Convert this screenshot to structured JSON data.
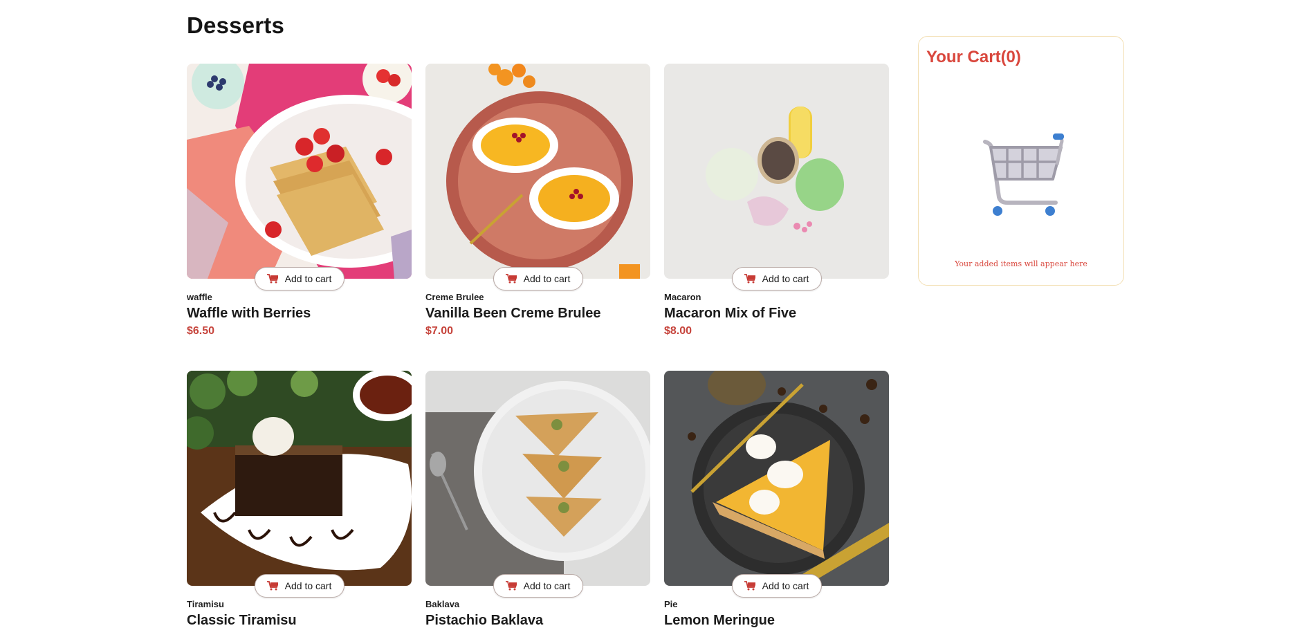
{
  "page": {
    "title": "Desserts"
  },
  "products": [
    {
      "category": "waffle",
      "name": "Waffle with Berries",
      "price": "$6.50",
      "button_label": "Add to cart",
      "image": "waffle-photo"
    },
    {
      "category": "Creme Brulee",
      "name": "Vanilla Been Creme Brulee",
      "price": "$7.00",
      "button_label": "Add to cart",
      "image": "creme-brulee-photo"
    },
    {
      "category": "Macaron",
      "name": "Macaron Mix of Five",
      "price": "$8.00",
      "button_label": "Add to cart",
      "image": "macaron-photo"
    },
    {
      "category": "Tiramisu",
      "name": "Classic Tiramisu",
      "price": "",
      "button_label": "Add to cart",
      "image": "tiramisu-photo"
    },
    {
      "category": "Baklava",
      "name": "Pistachio Baklava",
      "price": "",
      "button_label": "Add to cart",
      "image": "baklava-photo"
    },
    {
      "category": "Pie",
      "name": "Lemon Meringue",
      "price": "",
      "button_label": "Add to cart",
      "image": "pie-photo"
    }
  ],
  "cart": {
    "title": "Your Cart(0)",
    "empty_message": "Your added items will appear here",
    "illustration": "empty-cart-icon"
  },
  "colors": {
    "accent": "#d9473d",
    "price": "#c6433b",
    "cart_border": "#f3dfb3"
  },
  "icons": {
    "button_icon": "cart-icon"
  }
}
